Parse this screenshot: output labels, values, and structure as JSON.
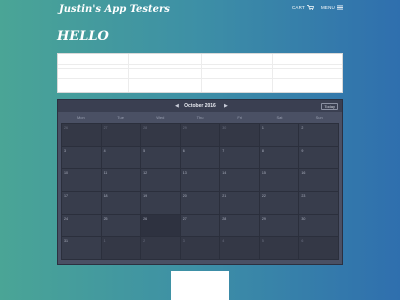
{
  "header": {
    "brand": "Justin's App Testers",
    "cart_label": "CART",
    "menu_label": "MENU"
  },
  "page": {
    "title": "HELLO"
  },
  "calendar": {
    "month_label": "October 2016",
    "prev_label": "◀",
    "next_label": "▶",
    "today_button": "Today",
    "weekdays": [
      "Mon",
      "Tue",
      "Wed",
      "Thu",
      "Fri",
      "Sat",
      "Sun"
    ],
    "weeks": [
      [
        "26",
        "27",
        "28",
        "29",
        "30",
        "1",
        "2"
      ],
      [
        "3",
        "4",
        "5",
        "6",
        "7",
        "8",
        "9"
      ],
      [
        "10",
        "11",
        "12",
        "13",
        "14",
        "15",
        "16"
      ],
      [
        "17",
        "18",
        "19",
        "20",
        "21",
        "22",
        "23"
      ],
      [
        "24",
        "25",
        "26",
        "27",
        "28",
        "29",
        "30"
      ],
      [
        "31",
        "1",
        "2",
        "3",
        "4",
        "5",
        "6"
      ]
    ]
  }
}
